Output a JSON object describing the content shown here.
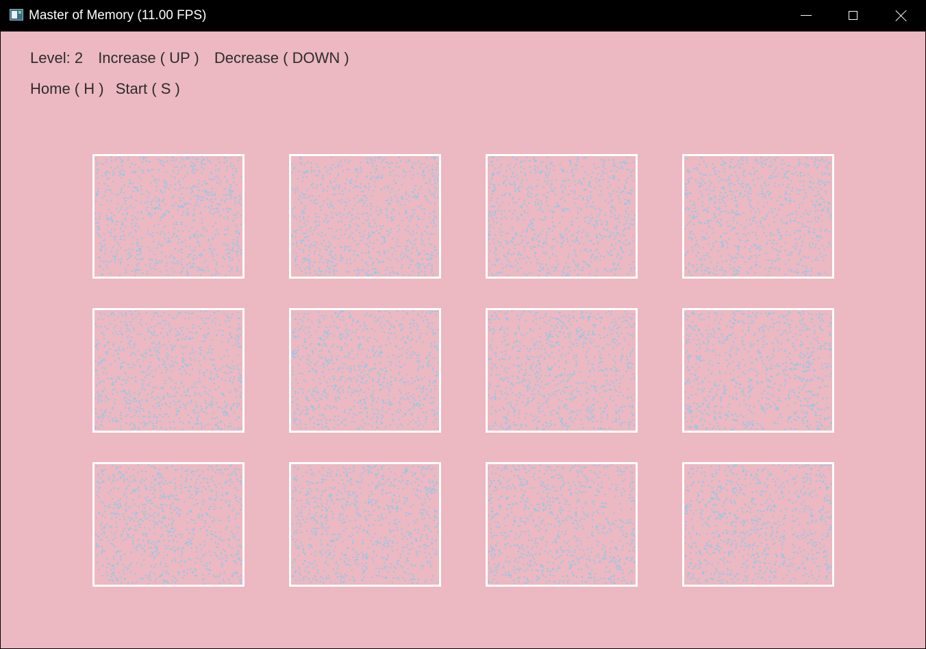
{
  "window": {
    "title": "Master of Memory (11.00 FPS)",
    "icons": [
      "app-icon",
      "minimize-icon",
      "maximize-icon",
      "close-icon"
    ]
  },
  "hud": {
    "level": "Level: 2",
    "increase": "Increase ( UP )",
    "decrease": "Decrease ( DOWN )",
    "home": "Home ( H )",
    "start": "Start ( S )"
  },
  "board": {
    "rows": 3,
    "columns": 4,
    "card_state": "face-down",
    "colors": {
      "background": "#ecb8c1",
      "card_border": "#ffffff",
      "card_pattern_dots": "#8ec8ea"
    }
  }
}
